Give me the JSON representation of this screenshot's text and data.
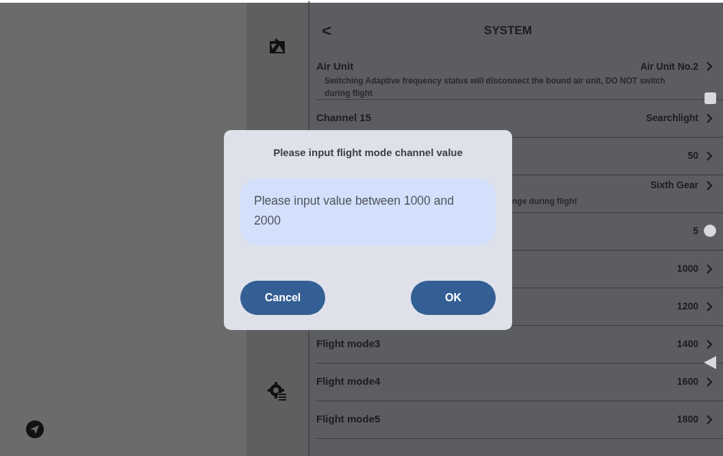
{
  "header": {
    "title": "SYSTEM",
    "back": "<"
  },
  "rows": [
    {
      "label": "Air Unit",
      "value": "Air Unit No.2",
      "note": "Switching Adaptive frequency status will disconnect the bound air unit, DO NOT switch during flight"
    },
    {
      "label": "Channel 15",
      "value": "Searchlight"
    },
    {
      "value": "50"
    },
    {
      "value": "Sixth Gear",
      "note_partial": "nge during flight"
    },
    {
      "value": "5"
    },
    {
      "value": "1000"
    },
    {
      "value": "1200"
    },
    {
      "label": "Flight mode3",
      "value": "1400"
    },
    {
      "label": "Flight mode4",
      "value": "1600"
    },
    {
      "label": "Flight mode5",
      "value": "1800"
    }
  ],
  "dialog": {
    "title": "Please input flight mode channel value",
    "placeholder": "Please input value between 1000 and 2000",
    "buttons": [
      "Cancel",
      "OK"
    ]
  }
}
